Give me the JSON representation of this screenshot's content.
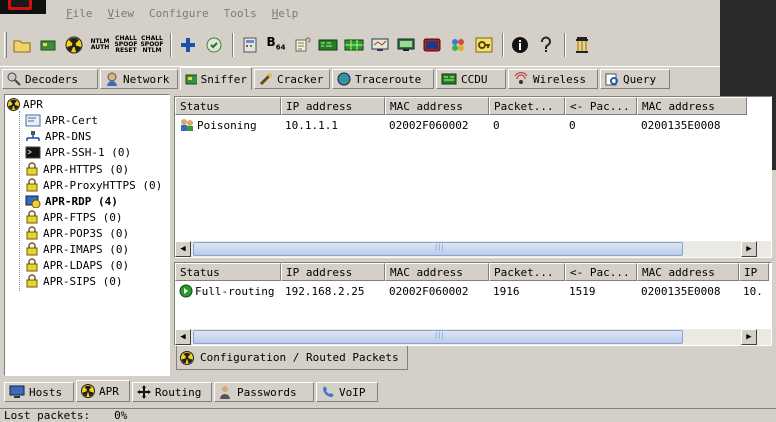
{
  "menu": [
    {
      "label": "File",
      "key": "F",
      "rest": "ile"
    },
    {
      "label": "View",
      "key": "V",
      "rest": "iew"
    },
    {
      "label": "Configure",
      "key": "",
      "rest": "Configure"
    },
    {
      "label": "Tools",
      "key": "",
      "rest": "Tools"
    },
    {
      "label": "Help",
      "key": "H",
      "rest": "elp"
    }
  ],
  "toolbar": {
    "ntlm_auth": [
      "NTLM",
      "AUTH"
    ],
    "chall_spoof_reset": [
      "CHALL",
      "SPOOF",
      "RESET"
    ],
    "chall_spoof_ntlm": [
      "CHALL",
      "SPOOF",
      "NTLM"
    ],
    "b64_label": "B",
    "b64_sub": "64"
  },
  "tabs": [
    {
      "label": "Decoders"
    },
    {
      "label": "Network"
    },
    {
      "label": "Sniffer"
    },
    {
      "label": "Cracker"
    },
    {
      "label": "Traceroute"
    },
    {
      "label": "CCDU"
    },
    {
      "label": "Wireless"
    },
    {
      "label": "Query"
    }
  ],
  "tree": {
    "root": "APR",
    "items": [
      {
        "label": "APR-Cert"
      },
      {
        "label": "APR-DNS"
      },
      {
        "label": "APR-SSH-1 (0)"
      },
      {
        "label": "APR-HTTPS (0)"
      },
      {
        "label": "APR-ProxyHTTPS (0)"
      },
      {
        "label": "APR-RDP (4)"
      },
      {
        "label": "APR-FTPS (0)"
      },
      {
        "label": "APR-POP3S (0)"
      },
      {
        "label": "APR-IMAPS (0)"
      },
      {
        "label": "APR-LDAPS (0)"
      },
      {
        "label": "APR-SIPS (0)"
      }
    ]
  },
  "table1": {
    "columns": [
      "Status",
      "IP address",
      "MAC address",
      "Packet...",
      "<- Pac...",
      "MAC address"
    ],
    "rows": [
      [
        "Poisoning",
        "10.1.1.1",
        "02002F060002",
        "0",
        "0",
        "0200135E0008"
      ]
    ]
  },
  "table2": {
    "columns": [
      "Status",
      "IP address",
      "MAC address",
      "Packet...",
      "<- Pac...",
      "MAC address",
      "IP"
    ],
    "rows": [
      [
        "Full-routing",
        "192.168.2.25",
        "02002F060002",
        "1916",
        "1519",
        "0200135E0008",
        "10."
      ]
    ]
  },
  "subtab": {
    "label": "Configuration / Routed Packets"
  },
  "bottom_tabs": [
    {
      "label": "Hosts"
    },
    {
      "label": "APR"
    },
    {
      "label": "Routing"
    },
    {
      "label": "Passwords"
    },
    {
      "label": "VoIP"
    }
  ],
  "status": {
    "lost_packets_label": "Lost packets:",
    "lost_packets_value": "0%"
  }
}
